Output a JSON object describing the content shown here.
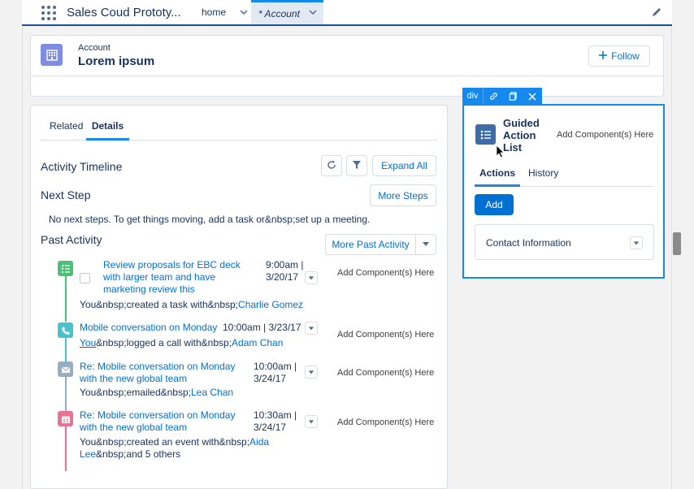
{
  "app": {
    "name": "Sales Coud Prototy..."
  },
  "nav": {
    "tabs": [
      {
        "label": "home"
      },
      {
        "label": "* Account"
      }
    ]
  },
  "record": {
    "type_label": "Account",
    "name": "Lorem ipsum",
    "follow_label": "Follow"
  },
  "tabs": {
    "related": "Related",
    "details": "Details"
  },
  "activity": {
    "title": "Activity Timeline",
    "expand_all": "Expand All",
    "next_step_title": "Next Step",
    "more_steps": "More Steps",
    "no_next_steps": "No next steps. To get things moving, add a task or&nbsp;set up a meeting.",
    "past_activity_title": "Past Activity",
    "more_past_activity": "More Past Activity",
    "items": [
      {
        "type": "task",
        "title": "Review proposals for EBC deck with larger team and have marketing review this",
        "date": "9:00am | 3/20/17",
        "sub_prefix": "You&nbsp;created a task with&nbsp;",
        "sub_link": "Charlie Gomez",
        "sub_suffix": "",
        "add_component": "Add Component(s) Here"
      },
      {
        "type": "call",
        "title": "Mobile conversation on Monday",
        "date": "10:00am | 3/23/17",
        "sub_link_first": "You",
        "sub_prefix": "&nbsp;logged a call with&nbsp;",
        "sub_link": "Adam Chan",
        "add_component": "Add Component(s) Here"
      },
      {
        "type": "email",
        "title": "Re: Mobile conversation on Monday with the new global team",
        "date": "10:00am | 3/24/17",
        "sub_prefix": "You&nbsp;emailed&nbsp;",
        "sub_link": "Lea Chan",
        "sub_suffix": "",
        "add_component": "Add Component(s) Here"
      },
      {
        "type": "event",
        "title": "Re: Mobile conversation on Monday with the new global team",
        "date": "10:30am | 3/24/17",
        "sub_prefix": "You&nbsp;created an event with&nbsp;",
        "sub_link": "Aida Lee",
        "sub_suffix": "&nbsp;and 5 others",
        "add_component": "Add Component(s) Here"
      }
    ]
  },
  "guided": {
    "toolbar_label": "div",
    "title": "Guided Action List",
    "add_component": "Add Component(s) Here",
    "tab_actions": "Actions",
    "tab_history": "History",
    "add_button": "Add",
    "contact_info": "Contact Information"
  },
  "colors": {
    "brand_blue": "#0070d2",
    "accent_blue": "#1589ee",
    "task_green": "#4bc076",
    "call_teal": "#48c3cc",
    "email_gray": "#95aec5",
    "event_pink": "#eb7092"
  }
}
